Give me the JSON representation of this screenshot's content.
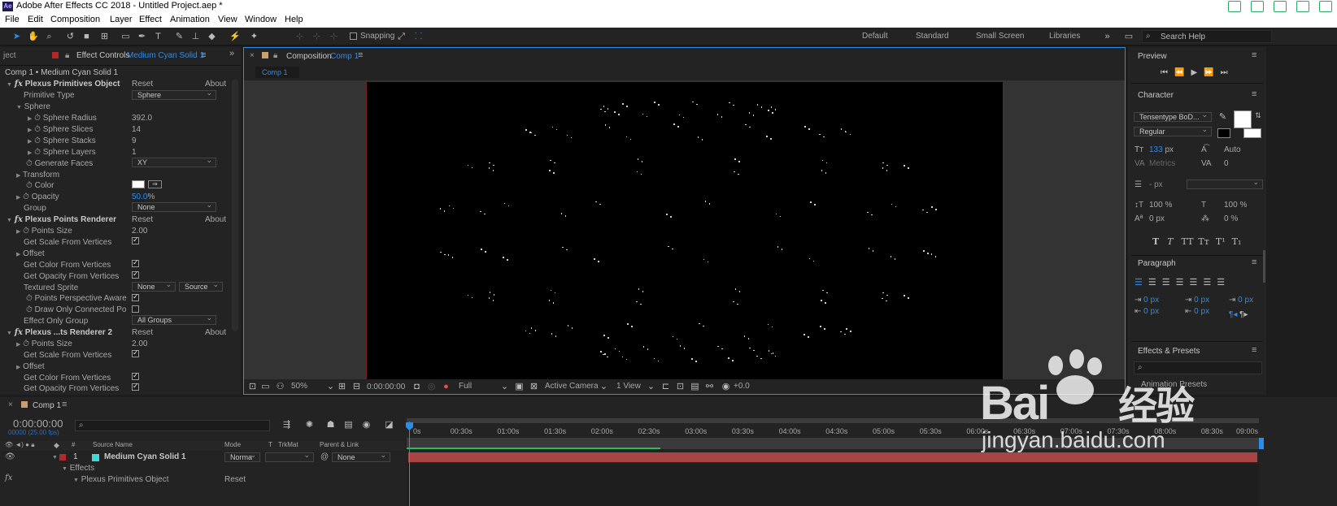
{
  "app": {
    "title": "Adobe After Effects CC 2018 - Untitled Project.aep *",
    "logo": "Ae"
  },
  "menu": [
    "File",
    "Edit",
    "Composition",
    "Layer",
    "Effect",
    "Animation",
    "View",
    "Window",
    "Help"
  ],
  "toolbar": {
    "snapping": "Snapping",
    "workspaces": [
      "Default",
      "Standard",
      "Small Screen",
      "Libraries"
    ],
    "search_placeholder": "Search Help"
  },
  "effect_controls": {
    "tab_prefix": "ject",
    "tab_label": "Effect Controls",
    "tab_layer": "Medium Cyan Solid 1",
    "breadcrumb": "Comp 1 • Medium Cyan Solid 1",
    "rows": [
      {
        "label": "Plexus Primitives Object",
        "reset": "Reset",
        "about": "About"
      },
      {
        "label": "Primitive Type",
        "value": "Sphere"
      },
      {
        "label": "Sphere"
      },
      {
        "label": "Sphere Radius",
        "value": "392.0"
      },
      {
        "label": "Sphere Slices",
        "value": "14"
      },
      {
        "label": "Sphere Stacks",
        "value": "9"
      },
      {
        "label": "Sphere Layers",
        "value": "1"
      },
      {
        "label": "Generate Faces",
        "value": "XY"
      },
      {
        "label": "Transform"
      },
      {
        "label": "Color"
      },
      {
        "label": "Opacity",
        "value": "50.0",
        "unit": "%"
      },
      {
        "label": "Group",
        "value": "None"
      },
      {
        "label": "Plexus Points Renderer",
        "reset": "Reset",
        "about": "About"
      },
      {
        "label": "Points Size",
        "value": "2.00"
      },
      {
        "label": "Get Scale From Vertices"
      },
      {
        "label": "Offset"
      },
      {
        "label": "Get Color From Vertices"
      },
      {
        "label": "Get Opacity From Vertices"
      },
      {
        "label": "Textured Sprite",
        "value": "None",
        "value2": "Source"
      },
      {
        "label": "Points Perspective Aware"
      },
      {
        "label": "Draw Only Connected Po"
      },
      {
        "label": "Effect Only Group",
        "value": "All Groups"
      },
      {
        "label": "Plexus ...ts Renderer 2",
        "reset": "Reset",
        "about": "About"
      },
      {
        "label": "Points Size",
        "value": "2.00"
      },
      {
        "label": "Get Scale From Vertices"
      },
      {
        "label": "Offset"
      },
      {
        "label": "Get Color From Vertices"
      },
      {
        "label": "Get Opacity From Vertices"
      }
    ]
  },
  "composition": {
    "tab_label": "Composition",
    "tab_comp": "Comp 1",
    "subtab": "Comp 1",
    "footer": {
      "zoom": "50%",
      "timecode": "0:00:00:00",
      "resolution": "Full",
      "camera": "Active Camera",
      "views": "1 View",
      "exposure": "+0.0"
    }
  },
  "right_panel": {
    "preview": "Preview",
    "character": "Character",
    "font": "Tensentype BoD...",
    "style": "Regular",
    "size": "133",
    "size_unit": "px",
    "leading": "Auto",
    "kerning": "Metrics",
    "tracking": "0",
    "stroke": "- px",
    "vscale": "100 %",
    "hscale": "100 %",
    "baseline": "0 px",
    "tsume": "0 %",
    "type_styles": [
      "T",
      "T",
      "TT",
      "Tт",
      "T¹",
      "T₁"
    ],
    "paragraph": "Paragraph",
    "indent_vals": [
      "0 px",
      "0 px",
      "0 px",
      "0 px",
      "0 px"
    ],
    "effects_presets": "Effects & Presets",
    "effects_item": "Animation Presets"
  },
  "timeline": {
    "tab": "Comp 1",
    "timecode": "0:00:00:00",
    "fps": "00000 (25.00 fps)",
    "cols": [
      "#",
      "Source Name",
      "Mode",
      "T",
      "TrkMat",
      "Parent & Link"
    ],
    "layer": {
      "num": "1",
      "name": "Medium Cyan Solid 1",
      "mode": "Norma",
      "parent": "None"
    },
    "effects": "Effects",
    "effect_item": "Plexus Primitives Object",
    "reset": "Reset",
    "ruler": [
      "0s",
      "00:30s",
      "01:00s",
      "01:30s",
      "02:00s",
      "02:30s",
      "03:00s",
      "03:30s",
      "04:00s",
      "04:30s",
      "05:00s",
      "05:30s",
      "06:00s",
      "06:30s",
      "07:00s",
      "07:30s",
      "08:00s",
      "08:30s",
      "09:00s"
    ]
  },
  "watermark": {
    "brand": "Bai",
    "brand2": "经验",
    "url": "jingyan.baidu.com"
  },
  "colors": {
    "accent": "#2d8ceb",
    "layer_bar": "#b24848",
    "work_area": "#2ebd55"
  }
}
